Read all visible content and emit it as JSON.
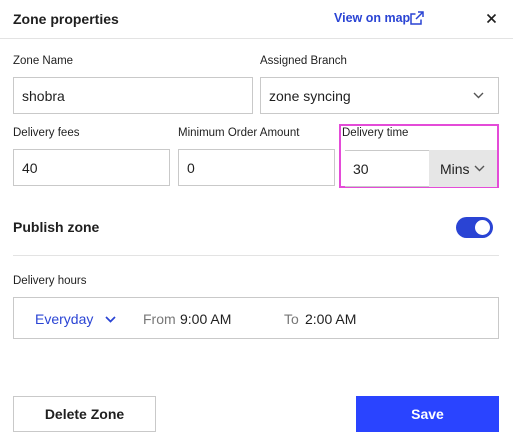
{
  "header": {
    "title": "Zone properties",
    "view_on_map": "View on map"
  },
  "form": {
    "zone_name": {
      "label": "Zone Name",
      "value": "shobra"
    },
    "assigned_branch": {
      "label": "Assigned Branch",
      "value": "zone syncing"
    },
    "delivery_fees": {
      "label": "Delivery fees",
      "value": "40"
    },
    "minimum_order": {
      "label": "Minimum Order Amount",
      "value": "0"
    },
    "delivery_time": {
      "label": "Delivery time",
      "value": "30",
      "unit": "Mins"
    }
  },
  "publish": {
    "label": "Publish zone",
    "enabled": true
  },
  "delivery_hours": {
    "label": "Delivery hours",
    "day": "Everyday",
    "from_label": "From",
    "from": "9:00 AM",
    "to_label": "To",
    "to": "2:00 AM"
  },
  "actions": {
    "delete": "Delete Zone",
    "save": "Save"
  },
  "colors": {
    "accent": "#2a44d4",
    "save_button": "#2a44ff",
    "highlight": "#e44bd8"
  },
  "icons": [
    "external-link-icon",
    "close-icon",
    "chevron-down-icon"
  ]
}
